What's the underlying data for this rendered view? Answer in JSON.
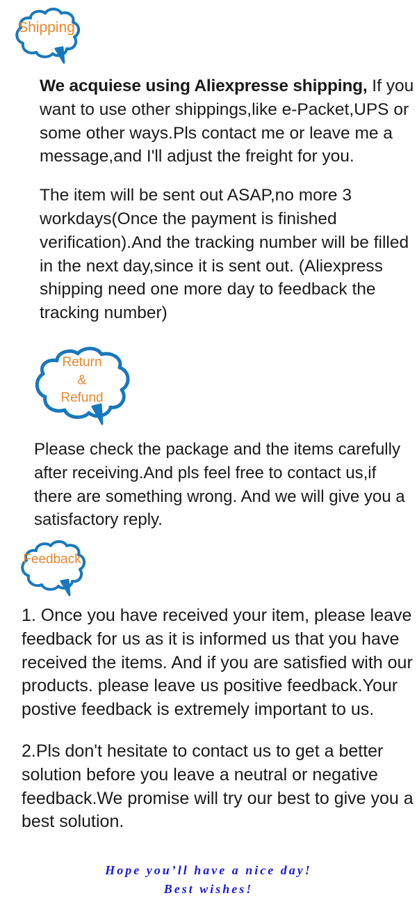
{
  "colors": {
    "bubble_outline": "#1878be",
    "bubble_fill": "#ffffff",
    "bubble_text": "#e8872b",
    "body_text": "#1a1a1a",
    "closing_text": "#1a1ae0",
    "page_background": "#ffffff"
  },
  "shipping": {
    "badge": {
      "label": "Shipping",
      "icon": "cloud-callout-icon"
    },
    "lead": "We acquiese using Aliexpresse shipping,",
    "paragraph_1_rest": "If you want to use other shippings,like e-Packet,UPS or some other ways.Pls contact me or leave me a message,and I'll adjust the freight for you.",
    "paragraph_2": "The item will be sent out ASAP,no more 3 workdays(Once the payment is finished verification).And the tracking number will be filled in the next day,since it is sent out. (Aliexpress shipping need one more day to feedback the tracking number)"
  },
  "return_refund": {
    "badge": {
      "line1": "Return",
      "line2": "&",
      "line3": "Refund",
      "icon": "cloud-callout-icon"
    },
    "paragraph_1": "Please check the package and the items carefully after receiving.And pls feel free to contact us,if there are something wrong. And we will give you a satisfactory reply."
  },
  "feedback": {
    "badge": {
      "label": "Feedback",
      "icon": "cloud-callout-icon"
    },
    "paragraph_1": "1. Once you have received your item, please leave feedback for us as it is informed us that you have received the items. And if you are satisfied with our products. please leave us positive feedback.Your postive feedback is extremely important to us.",
    "paragraph_2": "2.Pls don't hesitate to contact us to get a better solution before you leave a neutral or negative feedback.We promise will try our best to give you a best solution."
  },
  "closing": {
    "line1": "Hope you’ll have a nice day!",
    "line2": "Best wishes!"
  }
}
